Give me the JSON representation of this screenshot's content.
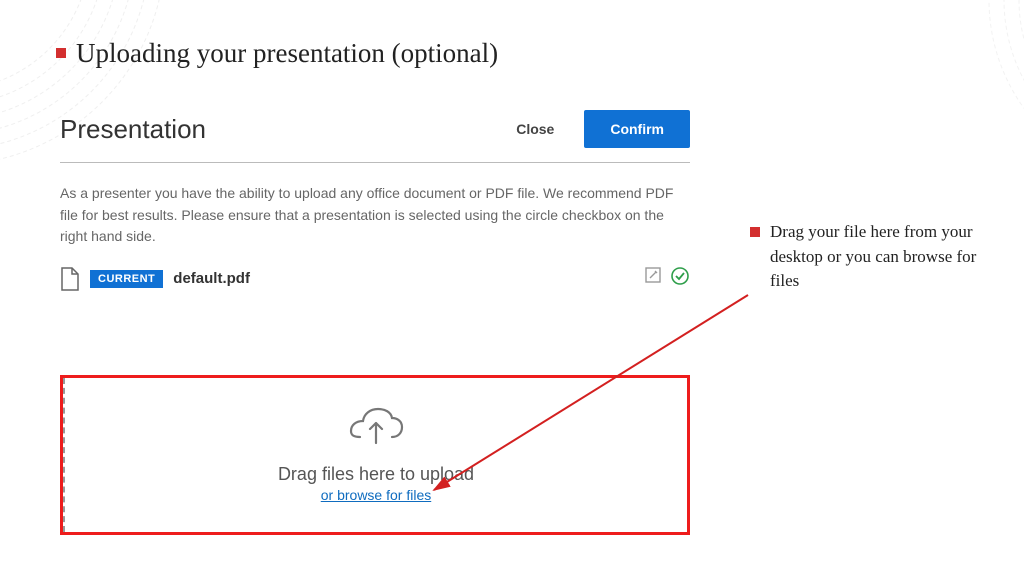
{
  "slide": {
    "title": "Uploading your presentation (optional)"
  },
  "dialog": {
    "title": "Presentation",
    "close_label": "Close",
    "confirm_label": "Confirm",
    "description": "As a presenter you have the ability to upload any office document or PDF file. We recommend PDF file for best results. Please ensure that a presentation is selected using the circle checkbox on the right hand side."
  },
  "file": {
    "badge": "CURRENT",
    "name": "default.pdf"
  },
  "dropzone": {
    "drag_text": "Drag files here to upload",
    "browse_text": "or browse for files"
  },
  "callout": {
    "text": "Drag your file here from your desktop or you can browse for files"
  }
}
